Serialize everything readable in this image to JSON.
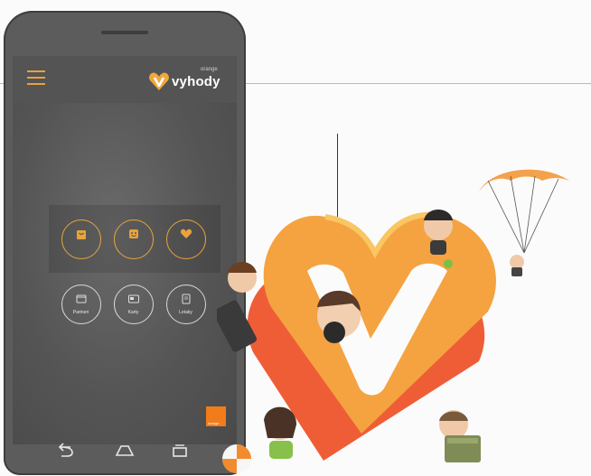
{
  "brand": {
    "name": "vyhody",
    "tag": "orange"
  },
  "menu": {
    "top": [
      {
        "label": "",
        "icon": "shopping-bag-icon"
      },
      {
        "label": "",
        "icon": "smile-icon"
      },
      {
        "label": "",
        "icon": "heart-icon"
      }
    ],
    "bottom": [
      {
        "label": "Partneri",
        "icon": "folder-icon"
      },
      {
        "label": "Karty",
        "icon": "cards-icon"
      },
      {
        "label": "Letaky",
        "icon": "document-icon"
      }
    ]
  },
  "operator_logo": {
    "text": "orange"
  },
  "colors": {
    "accent": "#e9a33a",
    "orange_brand": "#f27c1a"
  }
}
